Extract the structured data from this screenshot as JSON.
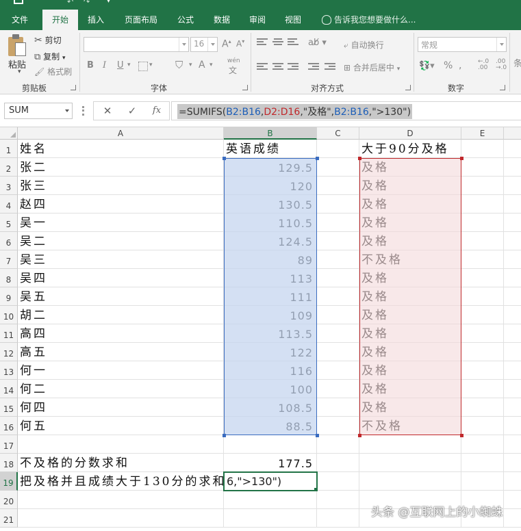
{
  "ribbon_tabs": [
    "文件",
    "开始",
    "插入",
    "页面布局",
    "公式",
    "数据",
    "审阅",
    "视图"
  ],
  "active_tab": "开始",
  "tell_me_placeholder": "告诉我您想要做什么...",
  "clipboard": {
    "paste_label": "粘贴",
    "cut_label": "剪切",
    "copy_label": "复制",
    "format_painter_label": "格式刷",
    "group_label": "剪贴板"
  },
  "font": {
    "family_value": "",
    "size_value": "16",
    "bold": "B",
    "italic": "I",
    "underline": "U",
    "phonetic": "wén",
    "group_label": "字体"
  },
  "alignment": {
    "wrap_text_label": "自动换行",
    "merge_center_label": "合并后居中",
    "group_label": "对齐方式"
  },
  "number": {
    "format_value": "常规",
    "percent_symbol": "%",
    "group_label": "数字"
  },
  "formula_bar": {
    "name_box": "SUM",
    "fx_label": "fx",
    "formula_parts": [
      {
        "text": "=SUMIFS(",
        "color": "plain"
      },
      {
        "text": "B2:B16",
        "color": "blue"
      },
      {
        "text": ",",
        "color": "plain"
      },
      {
        "text": "D2:D16",
        "color": "red"
      },
      {
        "text": ",\"及格\",",
        "color": "plain"
      },
      {
        "text": "B2:B16",
        "color": "blue"
      },
      {
        "text": ",\">130\")",
        "color": "plain"
      }
    ]
  },
  "columns": [
    "A",
    "B",
    "C",
    "D",
    "E"
  ],
  "selected_column": "B",
  "rows": [
    {
      "n": "1",
      "a": "姓名",
      "b": "英语成绩",
      "d": "大于90分及格"
    },
    {
      "n": "2",
      "a": "张二",
      "b": "129.5",
      "d": "及格"
    },
    {
      "n": "3",
      "a": "张三",
      "b": "120",
      "d": "及格"
    },
    {
      "n": "4",
      "a": "赵四",
      "b": "130.5",
      "d": "及格"
    },
    {
      "n": "5",
      "a": "吴一",
      "b": "110.5",
      "d": "及格"
    },
    {
      "n": "6",
      "a": "吴二",
      "b": "124.5",
      "d": "及格"
    },
    {
      "n": "7",
      "a": "吴三",
      "b": "89",
      "d": "不及格"
    },
    {
      "n": "8",
      "a": "吴四",
      "b": "113",
      "d": "及格"
    },
    {
      "n": "9",
      "a": "吴五",
      "b": "111",
      "d": "及格"
    },
    {
      "n": "10",
      "a": "胡二",
      "b": "109",
      "d": "及格"
    },
    {
      "n": "11",
      "a": "高四",
      "b": "113.5",
      "d": "及格"
    },
    {
      "n": "12",
      "a": "高五",
      "b": "122",
      "d": "及格"
    },
    {
      "n": "13",
      "a": "何一",
      "b": "116",
      "d": "及格"
    },
    {
      "n": "14",
      "a": "何二",
      "b": "100",
      "d": "及格"
    },
    {
      "n": "15",
      "a": "何四",
      "b": "108.5",
      "d": "及格"
    },
    {
      "n": "16",
      "a": "何五",
      "b": "88.5",
      "d": "不及格"
    },
    {
      "n": "17",
      "a": "",
      "b": "",
      "d": ""
    },
    {
      "n": "18",
      "a": "不及格的分数求和",
      "b": "177.5",
      "d": ""
    },
    {
      "n": "19",
      "a": "把及格并且成绩大于130分的求和",
      "b": "6,\">130\")",
      "d": ""
    },
    {
      "n": "20",
      "a": "",
      "b": "",
      "d": ""
    },
    {
      "n": "21",
      "a": "",
      "b": "",
      "d": ""
    }
  ],
  "active_row": "19",
  "watermark": "头条 @互联网上的小蜘蛛"
}
